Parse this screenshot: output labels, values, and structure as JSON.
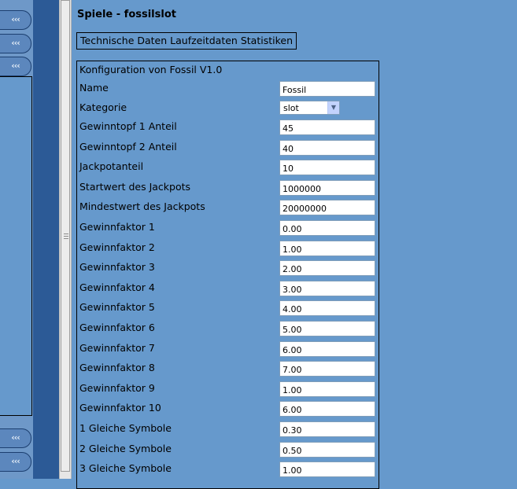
{
  "nav": {
    "collapse_glyph": "‹‹‹"
  },
  "page": {
    "title": "Spiele - fossilslot"
  },
  "tabs": [
    "Technische Daten",
    "Laufzeitdaten",
    "Statistiken"
  ],
  "config": {
    "title": "Konfiguration von Fossil V1.0",
    "name_label": "Name",
    "name_value": "Fossil",
    "category_label": "Kategorie",
    "category_value": "slot",
    "fields": [
      {
        "label": "Gewinntopf 1 Anteil",
        "value": "45"
      },
      {
        "label": "Gewinntopf 2 Anteil",
        "value": "40"
      },
      {
        "label": "Jackpotanteil",
        "value": "10"
      },
      {
        "label": "Startwert des Jackpots",
        "value": "1000000"
      },
      {
        "label": "Mindestwert des Jackpots",
        "value": "20000000"
      },
      {
        "label": "Gewinnfaktor 1",
        "value": "0.00"
      },
      {
        "label": "Gewinnfaktor 2",
        "value": "1.00"
      },
      {
        "label": "Gewinnfaktor 3",
        "value": "2.00"
      },
      {
        "label": "Gewinnfaktor 4",
        "value": "3.00"
      },
      {
        "label": "Gewinnfaktor 5",
        "value": "4.00"
      },
      {
        "label": "Gewinnfaktor 6",
        "value": "5.00"
      },
      {
        "label": "Gewinnfaktor 7",
        "value": "6.00"
      },
      {
        "label": "Gewinnfaktor 8",
        "value": "7.00"
      },
      {
        "label": "Gewinnfaktor 9",
        "value": "1.00"
      },
      {
        "label": "Gewinnfaktor 10",
        "value": "6.00"
      },
      {
        "label": "1 Gleiche Symbole",
        "value": "0.30"
      },
      {
        "label": "2 Gleiche Symbole",
        "value": "0.50"
      },
      {
        "label": "3 Gleiche Symbole",
        "value": "1.00"
      }
    ]
  }
}
